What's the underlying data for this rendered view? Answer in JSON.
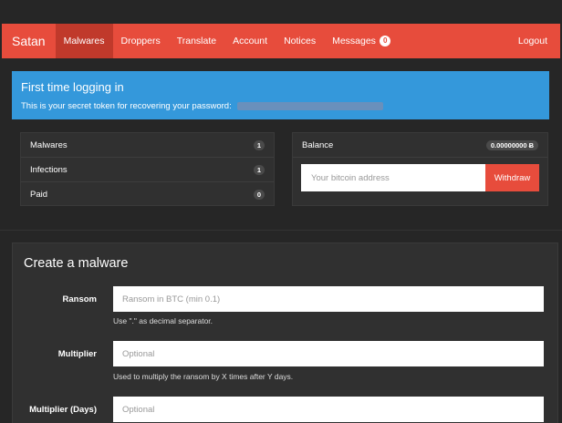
{
  "navbar": {
    "brand": "Satan",
    "items": [
      {
        "label": "Malwares"
      },
      {
        "label": "Droppers"
      },
      {
        "label": "Translate"
      },
      {
        "label": "Account"
      },
      {
        "label": "Notices"
      },
      {
        "label": "Messages",
        "badge": "0"
      }
    ],
    "logout": "Logout",
    "active_index": 0
  },
  "alert": {
    "title": "First time logging in",
    "text": "This is your secret token for recovering your password:"
  },
  "stats": {
    "rows": [
      {
        "label": "Malwares",
        "count": "1"
      },
      {
        "label": "Infections",
        "count": "1"
      },
      {
        "label": "Paid",
        "count": "0"
      }
    ]
  },
  "wallet": {
    "balance_label": "Balance",
    "balance_value": "0.00000000 Ƀ",
    "address_placeholder": "Your bitcoin address",
    "withdraw_label": "Withdraw"
  },
  "create": {
    "title": "Create a malware",
    "fields": [
      {
        "label": "Ransom",
        "placeholder": "Ransom in BTC (min 0.1)",
        "help": "Use \".\" as decimal separator."
      },
      {
        "label": "Multiplier",
        "placeholder": "Optional",
        "help": "Used to multiply the ransom by X times after Y days."
      },
      {
        "label": "Multiplier (Days)",
        "placeholder": "Optional"
      }
    ]
  },
  "colors": {
    "navbar": "#e74c3c",
    "navbar_active": "#c0392b",
    "alert": "#3498db",
    "background": "#262626",
    "panel": "#303030"
  }
}
